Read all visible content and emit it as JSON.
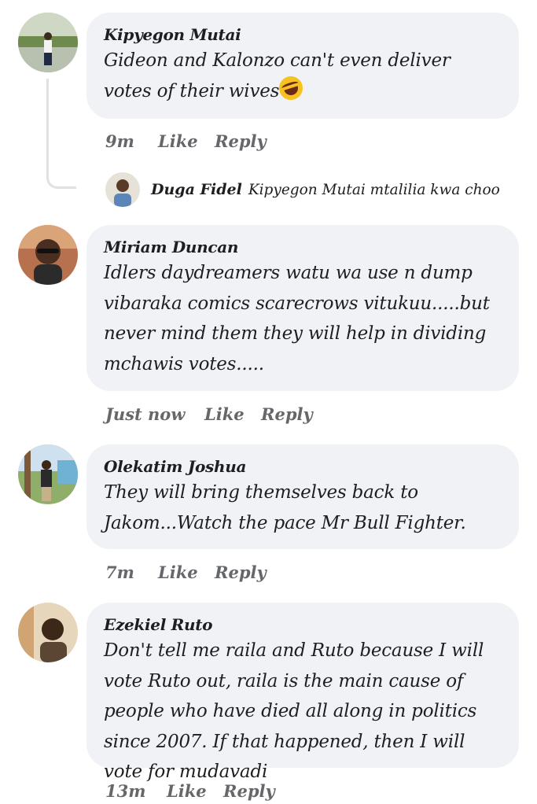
{
  "actions": {
    "like": "Like",
    "reply": "Reply"
  },
  "comments": [
    {
      "author": "Kipyegon Mutai",
      "text": "Gideon and Kalonzo can't even deliver votes of their wives",
      "emoji": "rolling-on-floor-laughing-emoji",
      "time": "9m"
    },
    {
      "author": "Miriam Duncan",
      "text": "Idlers daydreamers watu wa use n dump vibaraka comics scarecrows vitukuu.....but never mind them they will help in dividing mchawis votes.....",
      "time": "Just now"
    },
    {
      "author": "Olekatim Joshua",
      "text": "They will bring themselves back to Jakom...Watch the pace Mr Bull Fighter.",
      "time": "7m"
    },
    {
      "author": "Ezekiel Ruto",
      "text": "Don't tell me raila and Ruto because I will vote Ruto out, raila is the main cause of people who have died all along in politics since 2007. If that happened, then I will vote for mudavadi",
      "time": "13m"
    }
  ],
  "reply": {
    "author": "Duga Fidel",
    "text": "Kipyegon Mutai mtalilia kwa choo"
  }
}
